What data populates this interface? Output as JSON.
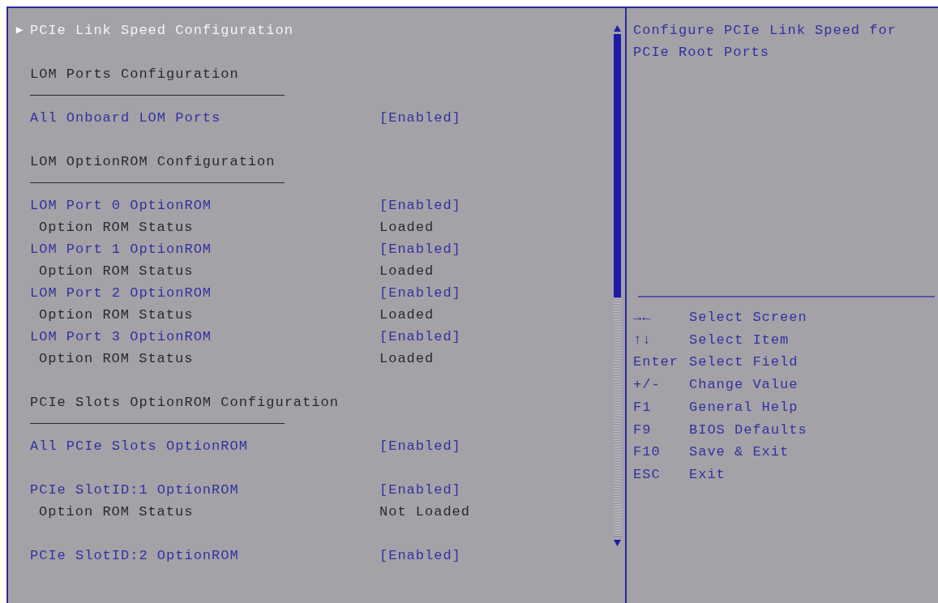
{
  "blocks": [
    {
      "kind": "submenu",
      "label": "PCIe Link Speed Configuration",
      "selected": true,
      "marker": "▶"
    },
    {
      "kind": "heading",
      "label": "LOM Ports Configuration"
    },
    {
      "kind": "rows",
      "rows": [
        {
          "kind": "setting",
          "label": "All Onboard LOM Ports",
          "value": "[Enabled]"
        }
      ]
    },
    {
      "kind": "heading",
      "label": "LOM OptionROM Configuration"
    },
    {
      "kind": "rows",
      "rows": [
        {
          "kind": "setting",
          "label": "LOM Port 0 OptionROM",
          "value": "[Enabled]"
        },
        {
          "kind": "info",
          "label": "Option ROM Status",
          "value": "Loaded"
        },
        {
          "kind": "setting",
          "label": "LOM Port 1 OptionROM",
          "value": "[Enabled]"
        },
        {
          "kind": "info",
          "label": "Option ROM Status",
          "value": "Loaded"
        },
        {
          "kind": "setting",
          "label": "LOM Port 2 OptionROM",
          "value": "[Enabled]"
        },
        {
          "kind": "info",
          "label": "Option ROM Status",
          "value": "Loaded"
        },
        {
          "kind": "setting",
          "label": "LOM Port 3 OptionROM",
          "value": "[Enabled]"
        },
        {
          "kind": "info",
          "label": "Option ROM Status",
          "value": "Loaded"
        }
      ]
    },
    {
      "kind": "heading",
      "label": "PCIe Slots OptionROM Configuration"
    },
    {
      "kind": "rows",
      "rows": [
        {
          "kind": "setting",
          "label": "All PCIe Slots OptionROM",
          "value": "[Enabled]"
        }
      ]
    },
    {
      "kind": "rows",
      "rows": [
        {
          "kind": "setting",
          "label": "PCIe SlotID:1 OptionROM",
          "value": "[Enabled]"
        },
        {
          "kind": "info",
          "label": "Option ROM Status",
          "value": "Not Loaded"
        }
      ]
    },
    {
      "kind": "rows",
      "rows": [
        {
          "kind": "setting",
          "label": "PCIe SlotID:2 OptionROM",
          "value": "[Enabled]"
        }
      ]
    }
  ],
  "help": "Configure PCIe Link Speed for PCIe Root Ports",
  "keys": [
    {
      "key": "→←",
      "action": "Select Screen"
    },
    {
      "key": "↑↓",
      "action": "Select Item"
    },
    {
      "key": "Enter",
      "action": "Select Field"
    },
    {
      "key": "+/-",
      "action": "Change Value"
    },
    {
      "key": "F1",
      "action": "General Help"
    },
    {
      "key": "F9",
      "action": "BIOS Defaults"
    },
    {
      "key": "F10",
      "action": "Save & Exit"
    },
    {
      "key": "ESC",
      "action": "Exit"
    }
  ]
}
